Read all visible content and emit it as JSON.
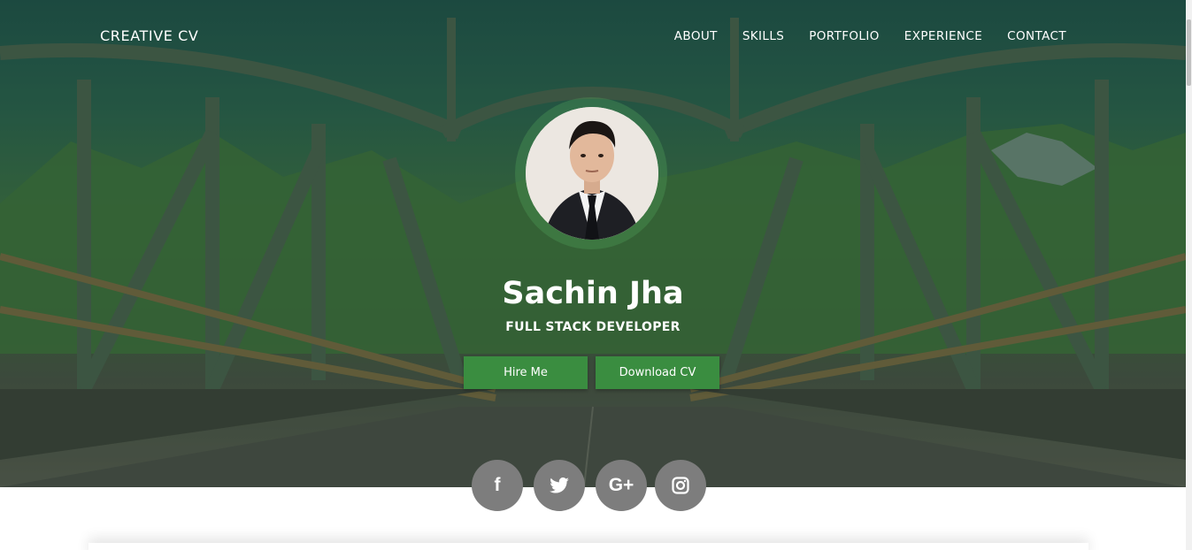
{
  "brand": "CREATIVE CV",
  "nav": {
    "items": [
      "ABOUT",
      "SKILLS",
      "PORTFOLIO",
      "EXPERIENCE",
      "CONTACT"
    ]
  },
  "profile": {
    "name": "Sachin Jha",
    "role": "FULL STACK DEVELOPER"
  },
  "buttons": {
    "hire": "Hire Me",
    "download": "Download CV"
  },
  "social": {
    "facebook": "f",
    "googleplus": "G+"
  },
  "colors": {
    "accent": "#3a8d40",
    "social_bg": "#7d7d7d",
    "hero_overlay": "#1f4a42"
  }
}
